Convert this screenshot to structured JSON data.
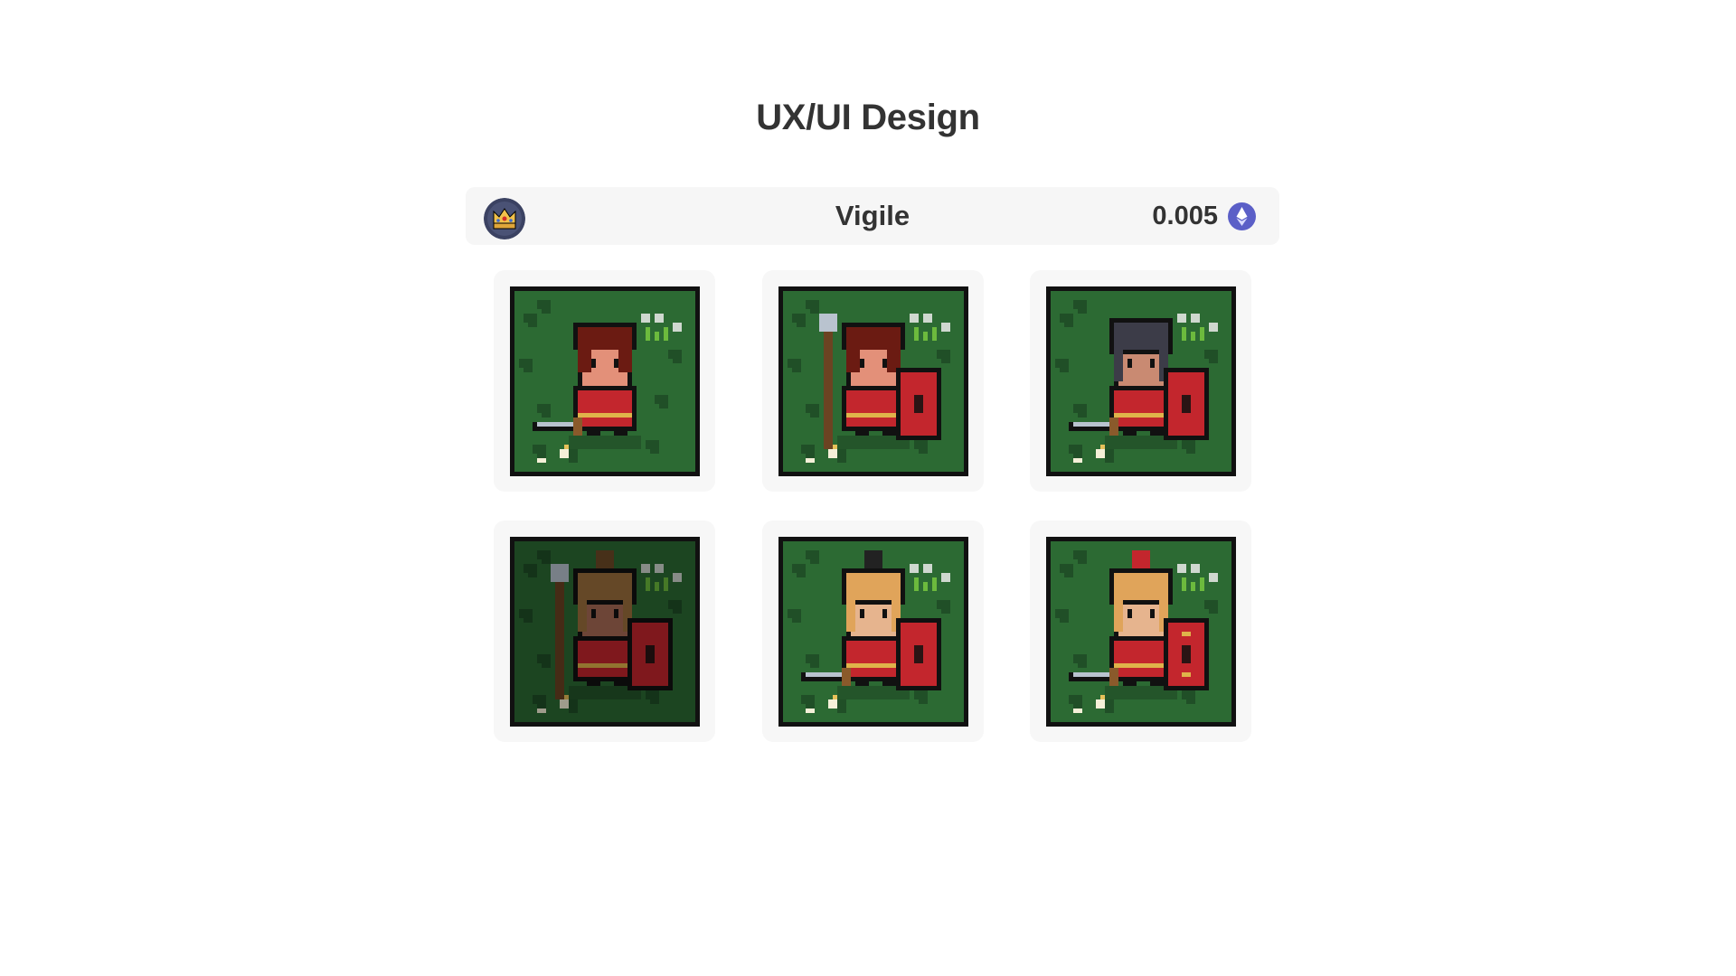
{
  "page": {
    "title": "UX/UI Design"
  },
  "header": {
    "badge_icon": "crown-badge-icon",
    "name": "Vigile",
    "price": "0.005",
    "currency_icon": "ethereum-icon",
    "currency_color": "#5b5fc7"
  },
  "nft_cards": [
    {
      "icon": "legionary-sword-icon",
      "helmet": "none",
      "hair": "#6b1b12",
      "skin": "#e39079",
      "weapon": "sword",
      "shield": false,
      "dimmed": false
    },
    {
      "icon": "legionary-spear-shield-icon",
      "helmet": "none",
      "hair": "#6b1b12",
      "skin": "#e39079",
      "weapon": "spear",
      "shield": true,
      "dimmed": false
    },
    {
      "icon": "dark-helmet-legionary-icon",
      "helmet": "dark",
      "hair": "#2a2a34",
      "skin": "#c98a72",
      "weapon": "sword",
      "shield": true,
      "dimmed": false
    },
    {
      "icon": "bronze-helmet-spear-legionary-icon",
      "helmet": "bronze",
      "hair": "#8a6034",
      "skin": "#a86b55",
      "weapon": "spear",
      "shield": true,
      "dimmed": true
    },
    {
      "icon": "black-crest-legionary-icon",
      "helmet": "gold-black-crest",
      "hair": "#d9a55c",
      "skin": "#e6b48e",
      "weapon": "sword",
      "shield": true,
      "dimmed": false
    },
    {
      "icon": "red-crest-legionary-icon",
      "helmet": "gold-red-crest",
      "hair": "#d9a55c",
      "skin": "#e6b48e",
      "weapon": "sword",
      "shield": true,
      "dimmed": false
    }
  ]
}
